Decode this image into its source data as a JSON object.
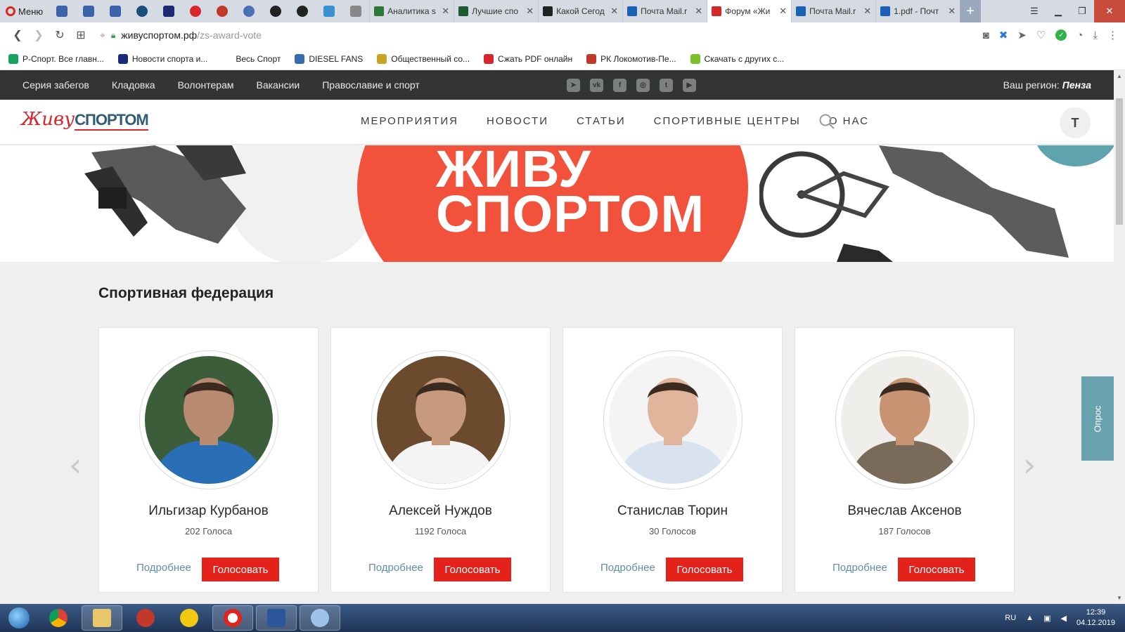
{
  "browser": {
    "menu_label": "Меню",
    "tabs": [
      {
        "title": "Аналитика s",
        "color": "#2b7a3a"
      },
      {
        "title": "Лучшие спо",
        "color": "#1d5a2e"
      },
      {
        "title": "Какой Сегод",
        "color": "#222222"
      },
      {
        "title": "Почта Mail.r",
        "color": "#1a5fb4"
      },
      {
        "title": "Форум «Жи",
        "color": "#d8262d"
      },
      {
        "title": "Почта Mail.r",
        "color": "#1a5fb4"
      },
      {
        "title": "1.pdf - Почт",
        "color": "#1a5fb4"
      }
    ],
    "active_tab_index": 4,
    "url_host": "живуспортом.рф",
    "url_path": "/zs-award-vote",
    "bookmarks": [
      {
        "label": "Р-Спорт. Все главн...",
        "color": "#1aa260"
      },
      {
        "label": "Новости спорта и...",
        "color": "#1b2a7a"
      },
      {
        "label": "Весь Спорт",
        "color": "#ffffff"
      },
      {
        "label": "DIESEL FANS",
        "color": "#3a6ab0"
      },
      {
        "label": "Общественный со...",
        "color": "#c8a227"
      },
      {
        "label": "Сжать PDF онлайн",
        "color": "#d8262d"
      },
      {
        "label": "РК Локомотив-Пе...",
        "color": "#c0392b"
      },
      {
        "label": "Скачать с других с...",
        "color": "#7bbf2a"
      }
    ]
  },
  "site": {
    "top_links": [
      "Серия забегов",
      "Кладовка",
      "Волонтерам",
      "Вакансии",
      "Православие и спорт"
    ],
    "region_label": "Ваш регион:",
    "region_value": "Пенза",
    "logo_script": "Живу",
    "logo_caps": "СПОРТОМ",
    "nav": [
      "МЕРОПРИЯТИЯ",
      "НОВОСТИ",
      "СТАТЬИ",
      "СПОРТИВНЫЕ ЦЕНТРЫ",
      "О НАС"
    ],
    "user_initial": "Т",
    "banner_line1": "ЖИВУ",
    "banner_line2": "СПОРТОМ"
  },
  "section": {
    "title": "Спортивная федерация",
    "more_label": "Подробнее",
    "vote_label": "Голосовать",
    "candidates": [
      {
        "name": "Ильгизар Курбанов",
        "votes": "202 Голоса",
        "skin": "#b88a72",
        "bg": "#3b5d3a",
        "shirt": "#2a6fb5"
      },
      {
        "name": "Алексей Нуждов",
        "votes": "1192 Голоса",
        "skin": "#c79a7e",
        "bg": "#6c4a2e",
        "shirt": "#f4f4f4"
      },
      {
        "name": "Станислав Тюрин",
        "votes": "30 Голосов",
        "skin": "#e0b59b",
        "bg": "#f4f4f4",
        "shirt": "#d9e3ef"
      },
      {
        "name": "Вячеслав Аксенов",
        "votes": "187 Голосов",
        "skin": "#c79372",
        "bg": "#f0eeea",
        "shirt": "#7a6a5a"
      }
    ]
  },
  "poll_label": "Опрос",
  "taskbar": {
    "lang": "RU",
    "time": "12:39",
    "date": "04.12.2019"
  }
}
